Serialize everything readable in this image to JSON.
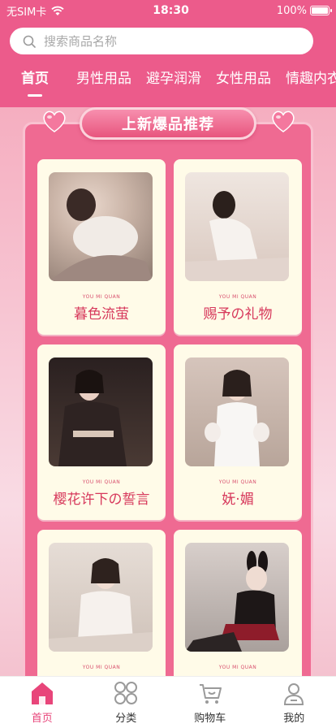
{
  "status_bar": {
    "carrier": "无SIM卡",
    "time": "18:30",
    "battery": "100%"
  },
  "search": {
    "placeholder": "搜索商品名称"
  },
  "tabs": [
    {
      "label": "首页",
      "active": true
    },
    {
      "label": "男性用品"
    },
    {
      "label": "避孕润滑"
    },
    {
      "label": "女性用品"
    },
    {
      "label": "情趣内衣"
    }
  ],
  "section": {
    "title": "上新爆品推荐"
  },
  "products": [
    {
      "brand": "YOU MI QUAN",
      "title": "暮色流萤"
    },
    {
      "brand": "YOU MI QUAN",
      "title": "赐予の礼物"
    },
    {
      "brand": "YOU MI QUAN",
      "title": "樱花许下の誓言"
    },
    {
      "brand": "YOU MI QUAN",
      "title": "妩·媚"
    },
    {
      "brand": "YOU MI QUAN",
      "title": ""
    },
    {
      "brand": "YOU MI QUAN",
      "title": ""
    }
  ],
  "tabbar": [
    {
      "label": "首页",
      "icon": "home-icon",
      "active": true
    },
    {
      "label": "分类",
      "icon": "category-icon"
    },
    {
      "label": "购物车",
      "icon": "cart-icon"
    },
    {
      "label": "我的",
      "icon": "profile-icon"
    }
  ],
  "colors": {
    "brand": "#ec5b8b",
    "panel": "#ef6a92",
    "accent_text": "#d7395c",
    "card": "#fffbe8"
  }
}
